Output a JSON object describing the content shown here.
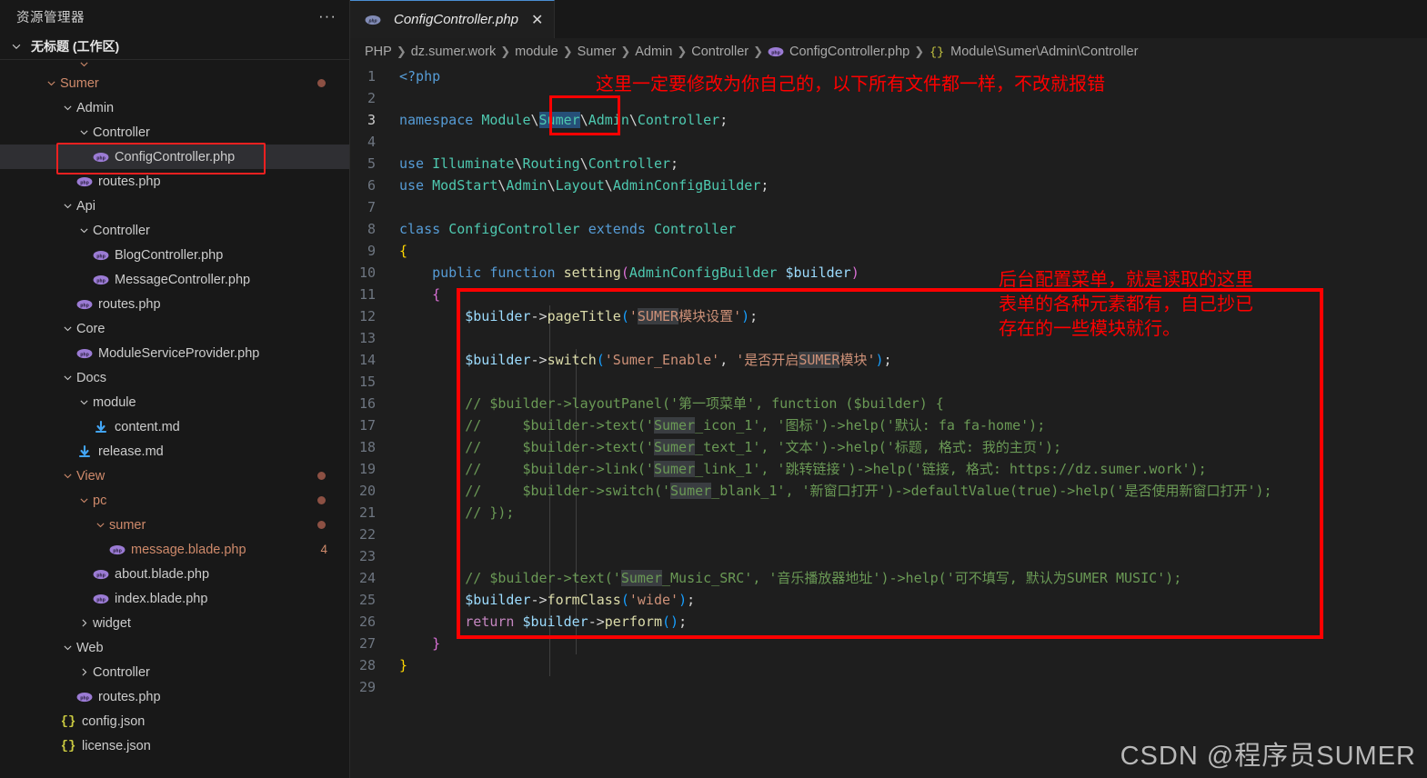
{
  "sidebar": {
    "title": "资源管理器",
    "more_label": "···",
    "workspace": "无标题 (工作区)",
    "clipped_top": "",
    "tree": [
      {
        "label": "Sumer",
        "indent": 3,
        "type": "folder",
        "expanded": true,
        "modified": true,
        "color": "mod"
      },
      {
        "label": "Admin",
        "indent": 4,
        "type": "folder",
        "expanded": true
      },
      {
        "label": "Controller",
        "indent": 5,
        "type": "folder",
        "expanded": true
      },
      {
        "label": "ConfigController.php",
        "indent": 6,
        "type": "php",
        "selected": true
      },
      {
        "label": "routes.php",
        "indent": 5,
        "type": "php"
      },
      {
        "label": "Api",
        "indent": 4,
        "type": "folder",
        "expanded": true
      },
      {
        "label": "Controller",
        "indent": 5,
        "type": "folder",
        "expanded": true
      },
      {
        "label": "BlogController.php",
        "indent": 6,
        "type": "php"
      },
      {
        "label": "MessageController.php",
        "indent": 6,
        "type": "php"
      },
      {
        "label": "routes.php",
        "indent": 5,
        "type": "php"
      },
      {
        "label": "Core",
        "indent": 4,
        "type": "folder",
        "expanded": true
      },
      {
        "label": "ModuleServiceProvider.php",
        "indent": 5,
        "type": "php"
      },
      {
        "label": "Docs",
        "indent": 4,
        "type": "folder",
        "expanded": true
      },
      {
        "label": "module",
        "indent": 5,
        "type": "folder",
        "expanded": true
      },
      {
        "label": "content.md",
        "indent": 6,
        "type": "md"
      },
      {
        "label": "release.md",
        "indent": 5,
        "type": "md"
      },
      {
        "label": "View",
        "indent": 4,
        "type": "folder",
        "expanded": true,
        "modified": true,
        "color": "mod"
      },
      {
        "label": "pc",
        "indent": 5,
        "type": "folder",
        "expanded": true,
        "modified": true,
        "color": "mod"
      },
      {
        "label": "sumer",
        "indent": 6,
        "type": "folder",
        "expanded": true,
        "modified": true,
        "color": "mod"
      },
      {
        "label": "message.blade.php",
        "indent": 7,
        "type": "php",
        "badge": "4",
        "color": "mod"
      },
      {
        "label": "about.blade.php",
        "indent": 6,
        "type": "php"
      },
      {
        "label": "index.blade.php",
        "indent": 6,
        "type": "php"
      },
      {
        "label": "widget",
        "indent": 5,
        "type": "folder",
        "expanded": false
      },
      {
        "label": "Web",
        "indent": 4,
        "type": "folder",
        "expanded": true
      },
      {
        "label": "Controller",
        "indent": 5,
        "type": "folder",
        "expanded": false
      },
      {
        "label": "routes.php",
        "indent": 5,
        "type": "php"
      },
      {
        "label": "config.json",
        "indent": 4,
        "type": "json"
      },
      {
        "label": "license.json",
        "indent": 4,
        "type": "json"
      }
    ]
  },
  "tab": {
    "label": "ConfigController.php",
    "close_label": "✕"
  },
  "breadcrumb": [
    {
      "text": "PHP"
    },
    {
      "text": "dz.sumer.work"
    },
    {
      "text": "module"
    },
    {
      "text": "Sumer"
    },
    {
      "text": "Admin"
    },
    {
      "text": "Controller"
    },
    {
      "text": "ConfigController.php",
      "icon": "php"
    },
    {
      "text": "Module\\Sumer\\Admin\\Controller",
      "icon": "braces"
    }
  ],
  "code": {
    "line_numbers": [
      "1",
      "2",
      "3",
      "4",
      "5",
      "6",
      "7",
      "8",
      "9",
      "10",
      "11",
      "12",
      "13",
      "14",
      "15",
      "16",
      "17",
      "18",
      "19",
      "20",
      "21",
      "22",
      "23",
      "24",
      "25",
      "26",
      "27",
      "28",
      "29"
    ],
    "lines": [
      "<?php",
      "",
      "namespace Module\\Sumer\\Admin\\Controller;",
      "",
      "use Illuminate\\Routing\\Controller;",
      "use ModStart\\Admin\\Layout\\AdminConfigBuilder;",
      "",
      "class ConfigController extends Controller",
      "{",
      "    public function setting(AdminConfigBuilder $builder)",
      "    {",
      "        $builder->pageTitle('SUMER模块设置');",
      "",
      "        $builder->switch('Sumer_Enable', '是否开启SUMER模块');",
      "",
      "        // $builder->layoutPanel('第一项菜单', function ($builder) {",
      "        //     $builder->text('Sumer_icon_1', '图标')->help('默认: fa fa-home');",
      "        //     $builder->text('Sumer_text_1', '文本')->help('标题, 格式: 我的主页');",
      "        //     $builder->link('Sumer_link_1', '跳转链接')->help('链接, 格式: https://dz.sumer.work');",
      "        //     $builder->switch('Sumer_blank_1', '新窗口打开')->defaultValue(true)->help('是否使用新窗口打开');",
      "        // });",
      "",
      "",
      "        // $builder->text('Sumer_Music_SRC', '音乐播放器地址')->help('可不填写, 默认为SUMER MUSIC');",
      "        $builder->formClass('wide');",
      "        return $builder->perform();",
      "    }",
      "}",
      ""
    ]
  },
  "annotations": {
    "top_note": "这里一定要修改为你自己的，以下所有文件都一样，不改就报错",
    "right_note_line1": "后台配置菜单，就是读取的这里",
    "right_note_line2": "表单的各种元素都有，自己抄已",
    "right_note_line3": "存在的一些模块就行。"
  },
  "watermark": "CSDN @程序员SUMER",
  "colors": {
    "annotation_red": "#ff0000",
    "modified_orange": "#cf8a6b",
    "tab_active_border": "#4a8fd4",
    "selection_blue": "#264f78"
  }
}
